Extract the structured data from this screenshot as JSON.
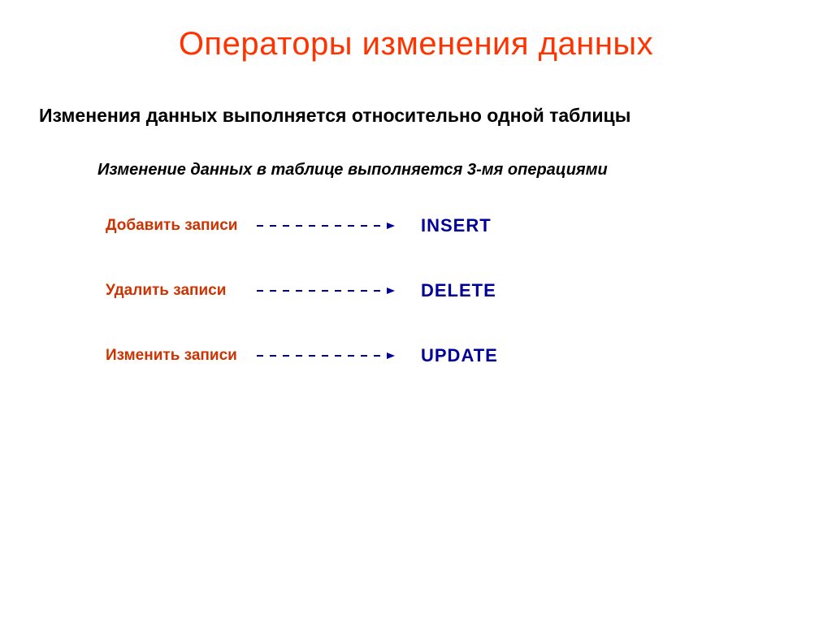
{
  "title": "Операторы изменения данных",
  "subtitle": "Изменения данных выполняется относительно одной таблицы",
  "subtitle2": "Изменение данных в таблице выполняется 3-мя операциями",
  "operations": [
    {
      "label": "Добавить записи",
      "command": "INSERT"
    },
    {
      "label": "Удалить записи",
      "command": "DELETE"
    },
    {
      "label": "Изменить записи",
      "command": "UPDATE"
    }
  ],
  "colors": {
    "title": "#ff3300",
    "label": "#cc3300",
    "command": "#000099",
    "arrow": "#000099"
  }
}
